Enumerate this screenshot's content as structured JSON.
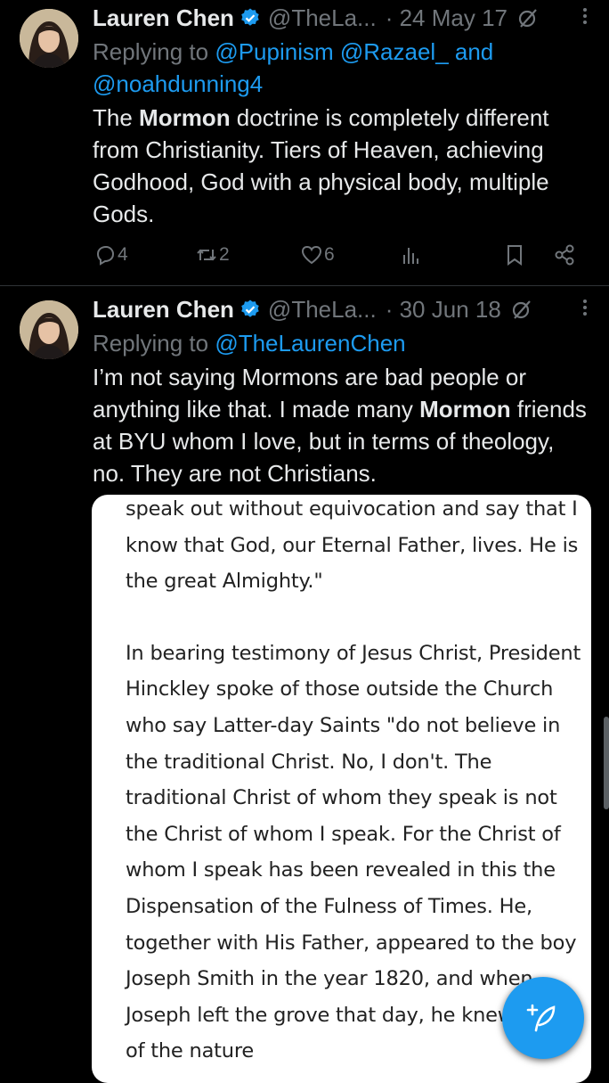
{
  "tweets": [
    {
      "author_name": "Lauren Chen",
      "handle": "@TheLa...",
      "date": "· 24 May 17",
      "replying_prefix": "Replying to ",
      "replying_mentions": "@Pupinism @Razael_ and",
      "replying_line2": "@noahdunning4",
      "text_part1": "The ",
      "text_bold": "Mormon",
      "text_part2": " doctrine is completely different from Christianity. Tiers of Heaven, achieving Godhood, God with a physical body, multiple Gods.",
      "reply_count": "4",
      "retweet_count": "2",
      "like_count": "6"
    },
    {
      "author_name": "Lauren Chen",
      "handle": "@TheLa...",
      "date": "· 30 Jun 18",
      "replying_prefix": "Replying to ",
      "replying_mentions": "@TheLaurenChen",
      "text_part1": "I’m not saying Mormons are bad people or anything like that. I made many ",
      "text_bold": "Mormon",
      "text_part2": " friends at BYU whom I love, but in terms of theology, no. They are not Christians."
    }
  ],
  "document_excerpt": {
    "para1": "speak out without equivocation and say that I know that God, our Eternal Father, lives. He is the great Almighty.\"",
    "para2": "In bearing testimony of Jesus Christ, President Hinckley spoke of those outside the Church who say Latter-day Saints \"do not believe in the traditional Christ. No, I don't. The traditional Christ of whom they speak is not the Christ of whom I speak. For the Christ of whom I speak has been revealed in this the Dispensation of the Fulness of Times. He, together with His Father, appeared to the boy Joseph Smith in the year 1820, and when Joseph left the grove that day, he knew more of the nature"
  },
  "icons": {
    "verified": "verified-badge-icon",
    "grok": "grok-icon",
    "reply": "reply-icon",
    "retweet": "retweet-icon",
    "like": "heart-icon",
    "views": "analytics-icon",
    "bookmark": "bookmark-icon",
    "share": "share-icon",
    "compose": "compose-feather-icon"
  },
  "colors": {
    "accent": "#1d9bf0",
    "background": "#000000",
    "muted": "#71767b"
  }
}
